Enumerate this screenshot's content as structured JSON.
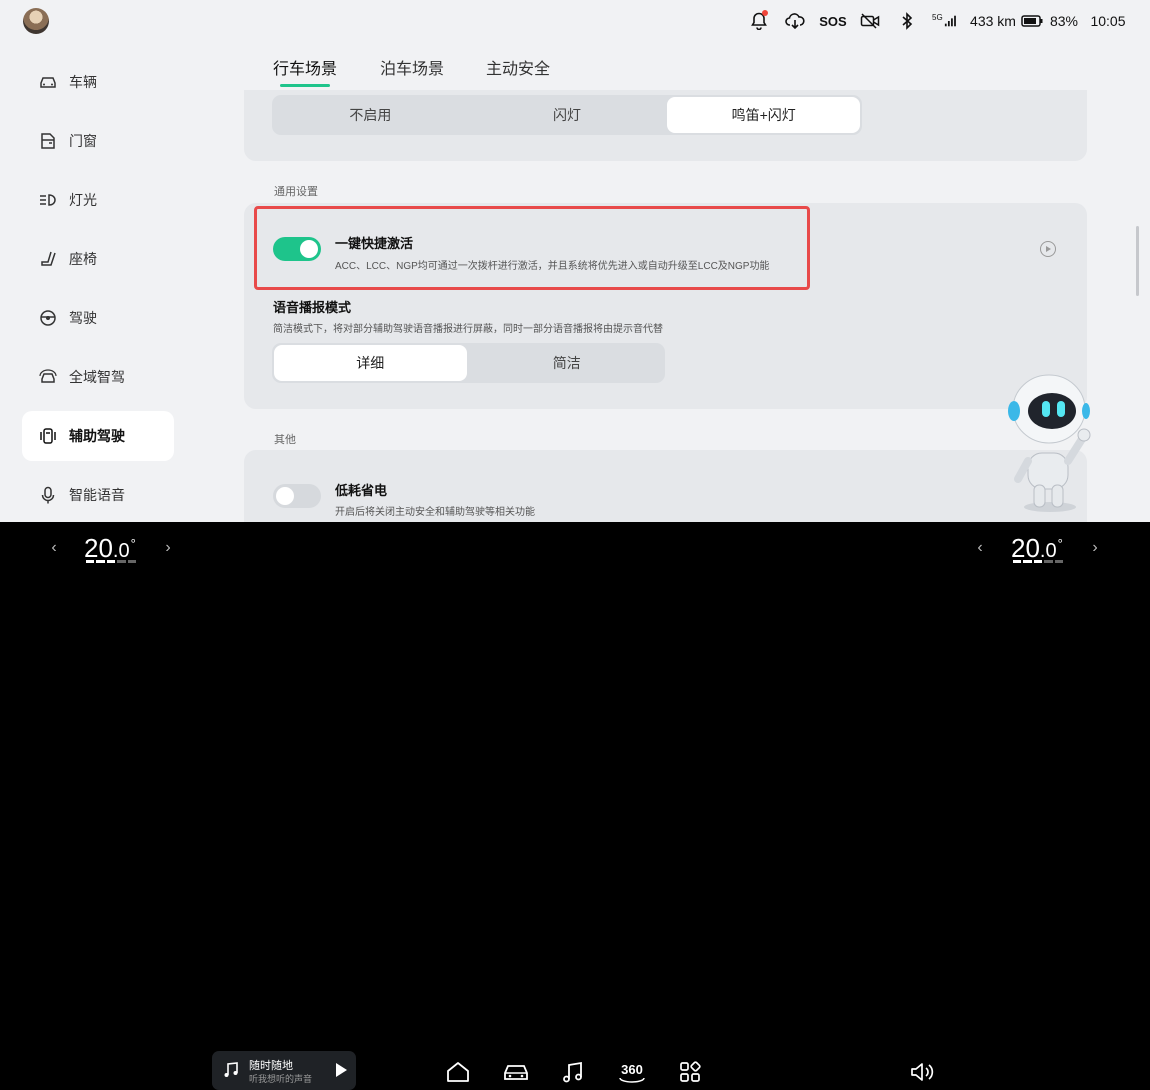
{
  "status": {
    "sos": "SOS",
    "network": "5G",
    "range": "433 km",
    "battery": "83%",
    "time": "10:05"
  },
  "sidebar": {
    "items": [
      {
        "label": "车辆",
        "icon": "car-icon"
      },
      {
        "label": "门窗",
        "icon": "door-icon"
      },
      {
        "label": "灯光",
        "icon": "headlight-icon"
      },
      {
        "label": "座椅",
        "icon": "seat-icon"
      },
      {
        "label": "驾驶",
        "icon": "steering-wheel-icon"
      },
      {
        "label": "全域智驾",
        "icon": "smart-drive-icon"
      },
      {
        "label": "辅助驾驶",
        "icon": "assist-drive-icon",
        "active": true
      },
      {
        "label": "智能语音",
        "icon": "microphone-icon"
      }
    ]
  },
  "tabs": [
    {
      "label": "行车场景",
      "active": true
    },
    {
      "label": "泊车场景"
    },
    {
      "label": "主动安全"
    }
  ],
  "alert_mode": {
    "options": [
      "不启用",
      "闪灯",
      "鸣笛+闪灯"
    ],
    "selected": "鸣笛+闪灯"
  },
  "general": {
    "header": "通用设置",
    "quick_activate": {
      "title": "一键快捷激活",
      "desc": "ACC、LCC、NGP均可通过一次拨杆进行激活，并且系统将优先进入或自动升级至LCC及NGP功能",
      "on": true
    },
    "voice": {
      "title": "语音播报模式",
      "desc": "简洁模式下，将对部分辅助驾驶语音播报进行屏蔽，同时一部分语音播报将由提示音代替",
      "options": [
        "详细",
        "简洁"
      ],
      "selected": "详细"
    }
  },
  "other": {
    "header": "其他",
    "low_power": {
      "title": "低耗省电",
      "desc": "开启后将关闭主动安全和辅助驾驶等相关功能",
      "on": false
    }
  },
  "dock": {
    "left_temp": {
      "int": "20",
      "dec": ".0",
      "unit": "°"
    },
    "right_temp": {
      "int": "20",
      "dec": ".0",
      "unit": "°"
    },
    "music": {
      "title": "随时随地",
      "subtitle": "听我想听的声音"
    },
    "cam_label": "360"
  },
  "colors": {
    "accent": "#1ec48b",
    "highlight": "#e84a4a"
  }
}
